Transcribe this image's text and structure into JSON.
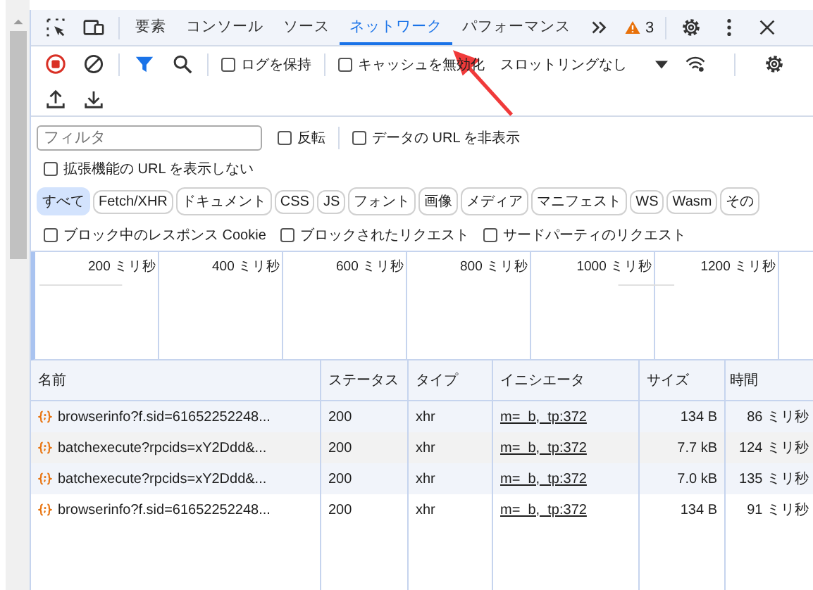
{
  "tabs": [
    {
      "label": "要素",
      "selected": false
    },
    {
      "label": "コンソール",
      "selected": false
    },
    {
      "label": "ソース",
      "selected": false
    },
    {
      "label": "ネットワーク",
      "selected": true
    },
    {
      "label": "パフォーマンス",
      "selected": false
    }
  ],
  "issues_count": "3",
  "toolbar": {
    "recording": true,
    "options": [
      {
        "label": "ログを保持",
        "checked": false
      },
      {
        "label": "キャッシュを無効化",
        "checked": false
      }
    ],
    "throttling": "スロットリングなし"
  },
  "filter": {
    "placeholder": "フィルタ",
    "options": [
      {
        "label": "反転",
        "checked": false
      },
      {
        "label": "データの URL を非表示",
        "checked": false
      }
    ],
    "extension_option": {
      "label": "拡張機能の URL を表示しない",
      "checked": false
    }
  },
  "types": [
    {
      "label": "すべて",
      "selected": true
    },
    {
      "label": "Fetch/XHR",
      "selected": false
    },
    {
      "label": "ドキュメント",
      "selected": false
    },
    {
      "label": "CSS",
      "selected": false
    },
    {
      "label": "JS",
      "selected": false
    },
    {
      "label": "フォント",
      "selected": false
    },
    {
      "label": "画像",
      "selected": false
    },
    {
      "label": "メディア",
      "selected": false
    },
    {
      "label": "マニフェスト",
      "selected": false
    },
    {
      "label": "WS",
      "selected": false
    },
    {
      "label": "Wasm",
      "selected": false
    },
    {
      "label": "その",
      "selected": false
    }
  ],
  "block_options": [
    {
      "label": "ブロック中のレスポンス Cookie",
      "checked": false
    },
    {
      "label": "ブロックされたリクエスト",
      "checked": false
    },
    {
      "label": "サードパーティのリクエスト",
      "checked": false
    }
  ],
  "timeline": {
    "ticks": [
      "200 ミリ秒",
      "400 ミリ秒",
      "600 ミリ秒",
      "800 ミリ秒",
      "1000 ミリ秒",
      "1200 ミリ秒"
    ]
  },
  "table": {
    "columns": [
      "名前",
      "ステータス",
      "タイプ",
      "イニシエータ",
      "サイズ",
      "時間"
    ],
    "rows": [
      {
        "name": "browserinfo?f.sid=61652252248...",
        "status": "200",
        "type": "xhr",
        "initiator": "m=_b,_tp:372",
        "size": "134 B",
        "time": "86 ミリ秒"
      },
      {
        "name": "batchexecute?rpcids=xY2Ddd&...",
        "status": "200",
        "type": "xhr",
        "initiator": "m=_b,_tp:372",
        "size": "7.7 kB",
        "time": "124 ミリ秒"
      },
      {
        "name": "batchexecute?rpcids=xY2Ddd&...",
        "status": "200",
        "type": "xhr",
        "initiator": "m=_b,_tp:372",
        "size": "7.0 kB",
        "time": "135 ミリ秒"
      },
      {
        "name": "browserinfo?f.sid=61652252248...",
        "status": "200",
        "type": "xhr",
        "initiator": "m=_b,_tp:372",
        "size": "134 B",
        "time": "91 ミリ秒"
      }
    ]
  }
}
